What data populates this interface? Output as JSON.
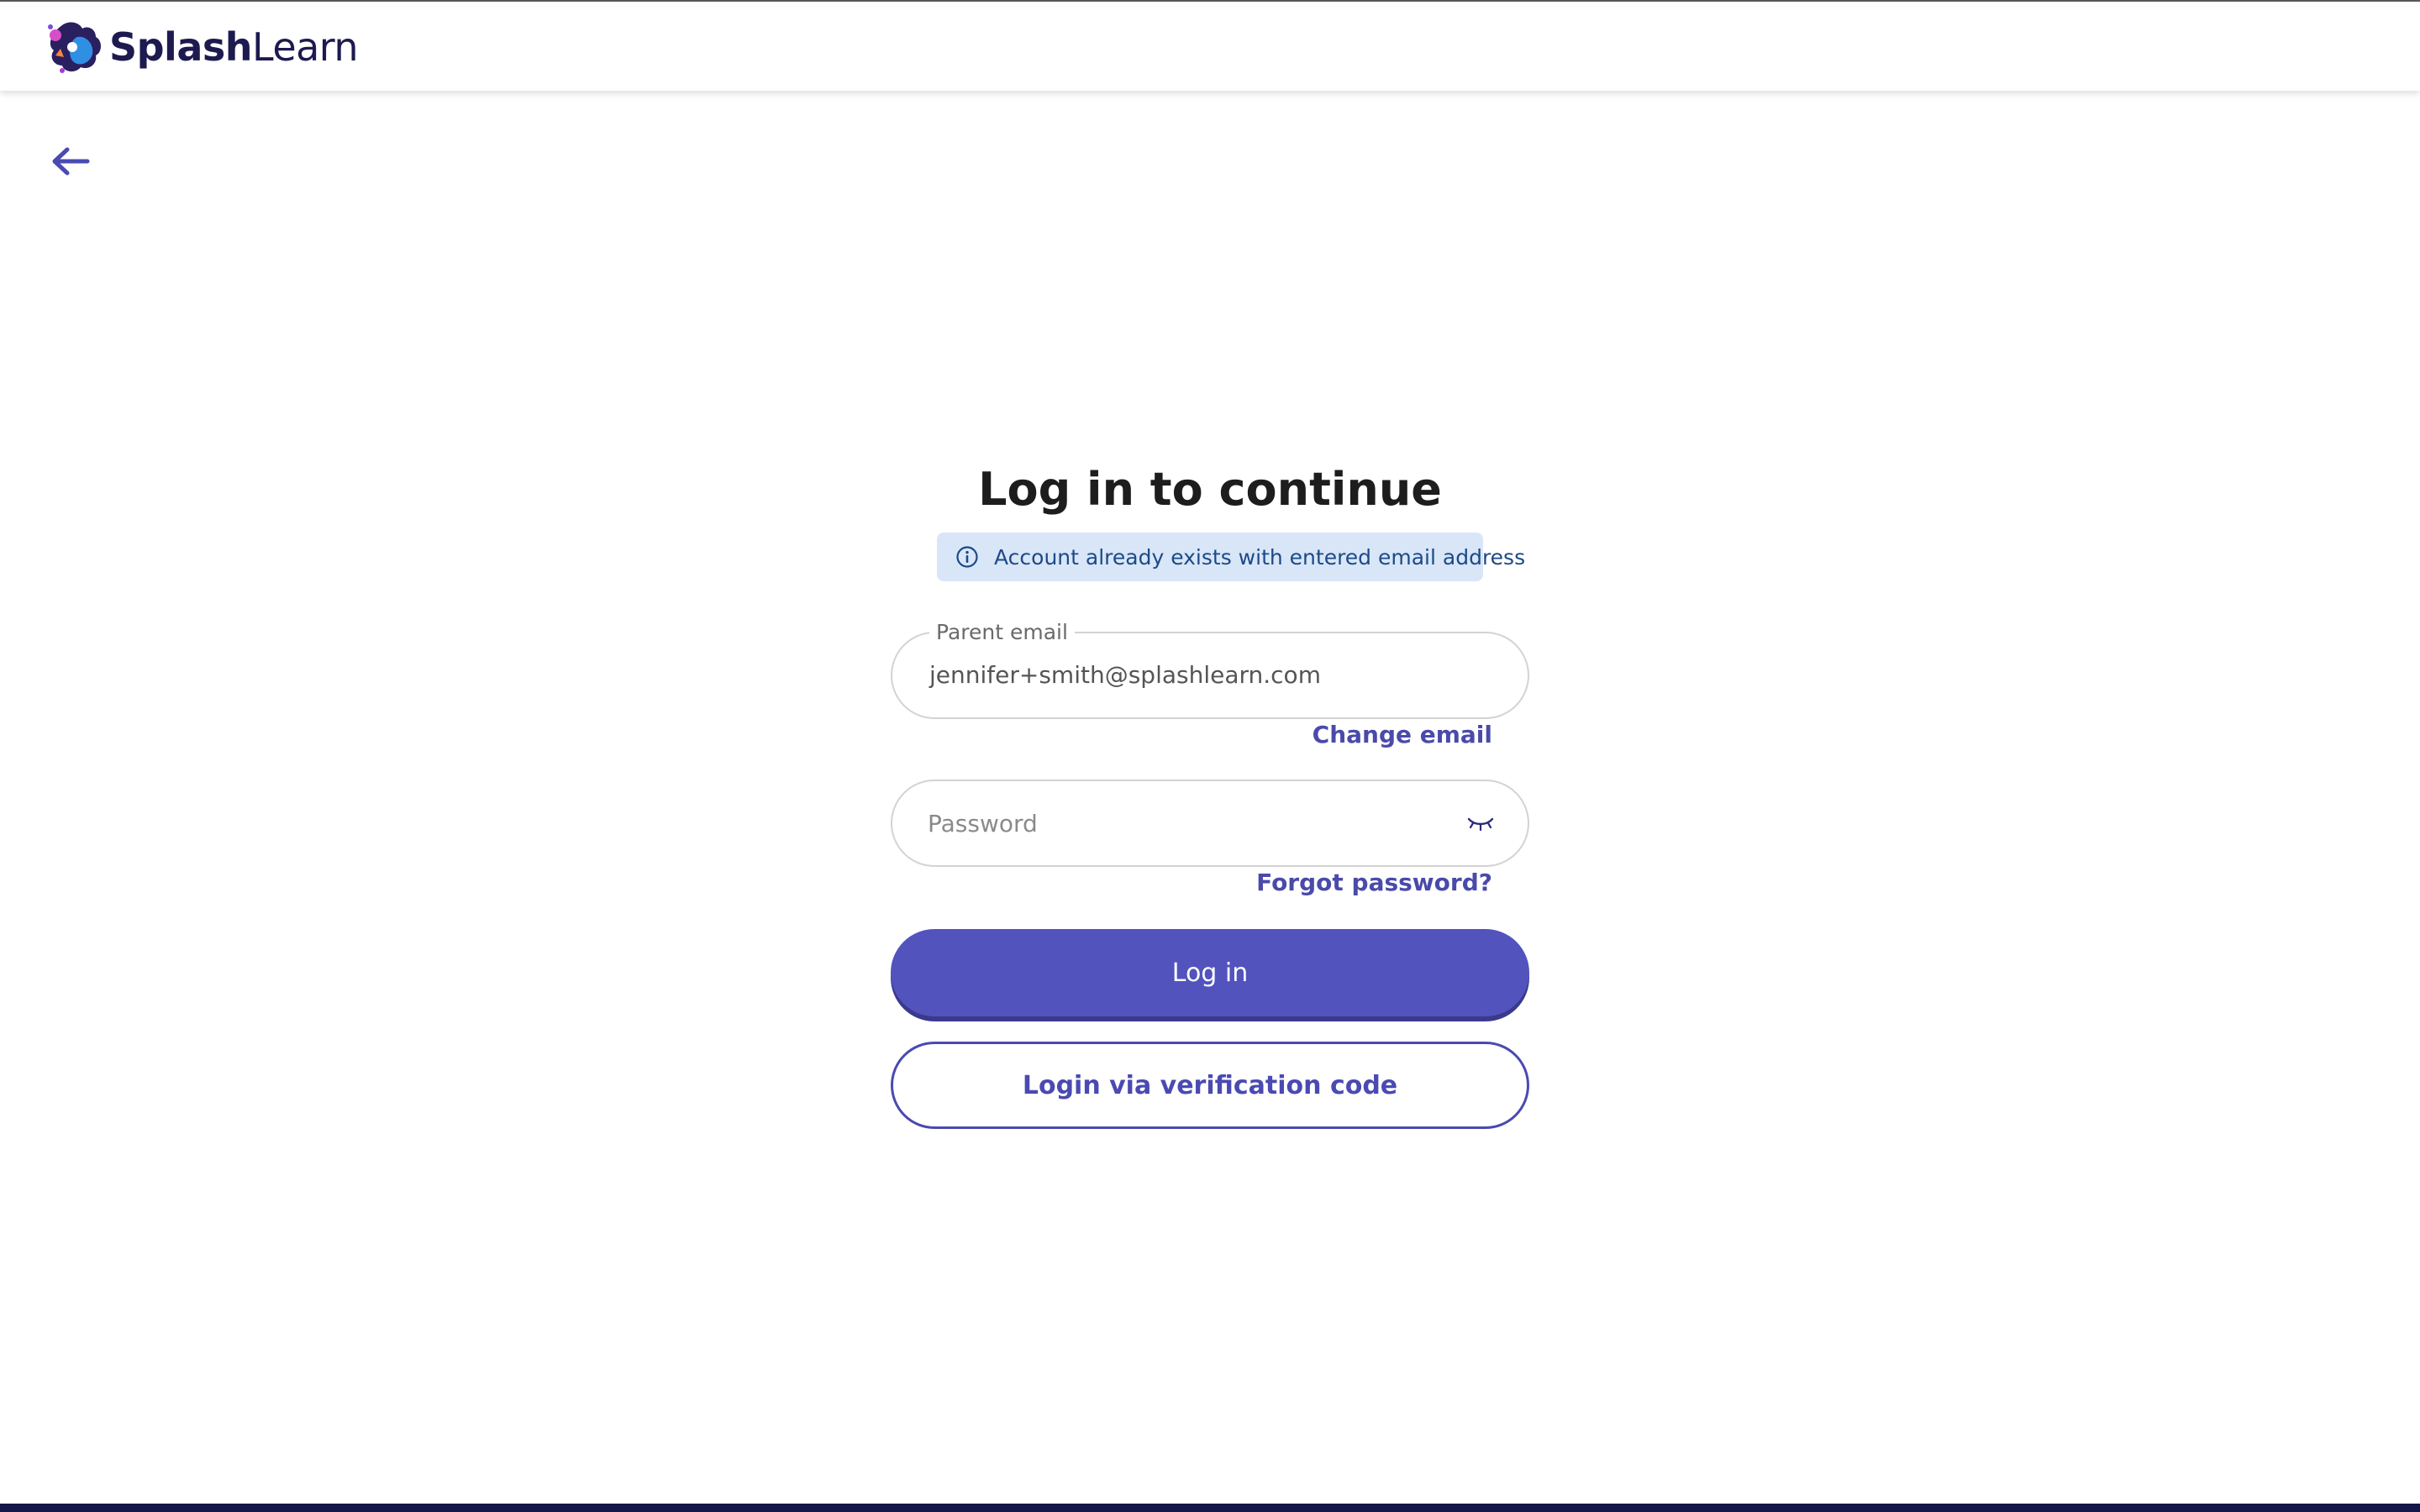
{
  "header": {
    "logo": {
      "brand_bold": "Splash",
      "brand_light": "Learn",
      "icon": "splashlearn-logo-mark"
    }
  },
  "navigation": {
    "back_icon": "arrow-left-icon"
  },
  "login": {
    "title": "Log in to continue",
    "notice": {
      "icon": "info-circle-icon",
      "text": "Account already exists with entered email address"
    },
    "email_field": {
      "label": "Parent email",
      "value": "jennifer+smith@splashlearn.com"
    },
    "change_email_link": "Change email",
    "password_field": {
      "placeholder": "Password",
      "toggle_icon": "eye-closed-icon"
    },
    "forgot_password_link": "Forgot password?",
    "login_button": "Log in",
    "verification_button": "Login via verification code"
  },
  "colors": {
    "primary": "#5253bd",
    "link": "#4a4aaa",
    "notice_bg": "#d8e6f8",
    "notice_text": "#1d4a86",
    "footer": "#14164a"
  }
}
